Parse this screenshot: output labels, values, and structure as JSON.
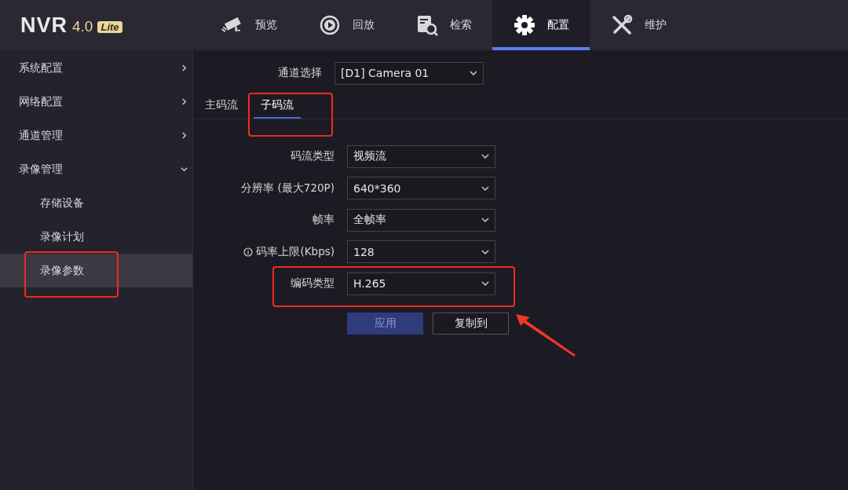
{
  "logo": {
    "name": "NVR",
    "version": "4.0",
    "edition": "Lite"
  },
  "nav_tabs": [
    {
      "label": "预览",
      "selected": false
    },
    {
      "label": "回放",
      "selected": false
    },
    {
      "label": "检索",
      "selected": false
    },
    {
      "label": "配置",
      "selected": true
    },
    {
      "label": "维护",
      "selected": false
    }
  ],
  "sidebar": {
    "items": [
      {
        "label": "系统配置",
        "expanded": false,
        "selected": false
      },
      {
        "label": "网络配置",
        "expanded": false,
        "selected": false
      },
      {
        "label": "通道管理",
        "expanded": false,
        "selected": false
      },
      {
        "label": "录像管理",
        "expanded": true,
        "selected": false,
        "children": [
          {
            "label": "存储设备",
            "selected": false
          },
          {
            "label": "录像计划",
            "selected": false
          },
          {
            "label": "录像参数",
            "selected": true
          }
        ]
      }
    ]
  },
  "channel_select": {
    "label": "通道选择",
    "value": "[D1] Camera 01"
  },
  "stream_tabs": [
    {
      "label": "主码流",
      "selected": false
    },
    {
      "label": "子码流",
      "selected": true
    }
  ],
  "fields": [
    {
      "label": "码流类型",
      "value": "视频流",
      "info_icon": false
    },
    {
      "label": "分辨率 (最大720P)",
      "value": "640*360",
      "info_icon": false
    },
    {
      "label": "帧率",
      "value": "全帧率",
      "info_icon": false
    },
    {
      "label": "码率上限(Kbps)",
      "value": "128",
      "info_icon": true
    },
    {
      "label": "编码类型",
      "value": "H.265",
      "info_icon": false
    }
  ],
  "buttons": [
    {
      "label": "应用",
      "kind": "primary"
    },
    {
      "label": "复制到",
      "kind": "secondary"
    }
  ]
}
